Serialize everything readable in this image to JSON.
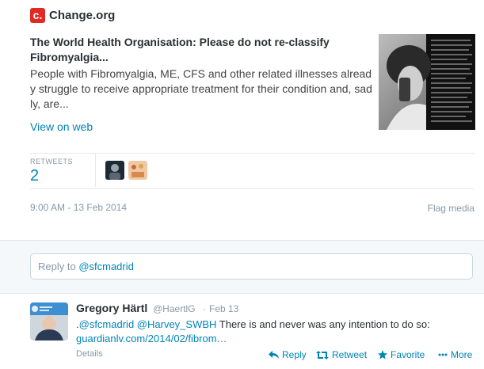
{
  "card": {
    "brand_initial": "c.",
    "brand_name": "Change.org",
    "title": "The World Health Organisation: Please do not re-classify Fibromyalgia...",
    "description": "People with Fibromyalgia, ME, CFS and other related illnesses already struggle to receive appropriate treatment for their condition and, sadly, are...",
    "view_on_web": "View on web"
  },
  "stats": {
    "retweets_label": "RETWEETS",
    "retweets_count": "2"
  },
  "meta": {
    "timestamp": "9:00 AM - 13 Feb 2014",
    "flag_media": "Flag media"
  },
  "reply_box": {
    "prefix": "Reply to ",
    "mention": "@sfcmadrid"
  },
  "reply_tweet": {
    "name": "Gregory Härtl",
    "handle": "@HaertlG",
    "separator": "·",
    "time": "Feb 13",
    "text_prefix": ".",
    "mention1": "@sfcmadrid",
    "mention2": "@Harvey_SWBH",
    "text_body": " There is and never was any intention to do so: ",
    "link": "guardianlv.com/2014/02/fibrom…",
    "details": "Details",
    "avatar_label": "World Health Organization"
  },
  "actions": {
    "reply": "Reply",
    "retweet": "Retweet",
    "favorite": "Favorite",
    "more": "More"
  },
  "colors": {
    "accent": "#0084b4",
    "brand": "#e12a26",
    "muted": "#8899a6"
  }
}
